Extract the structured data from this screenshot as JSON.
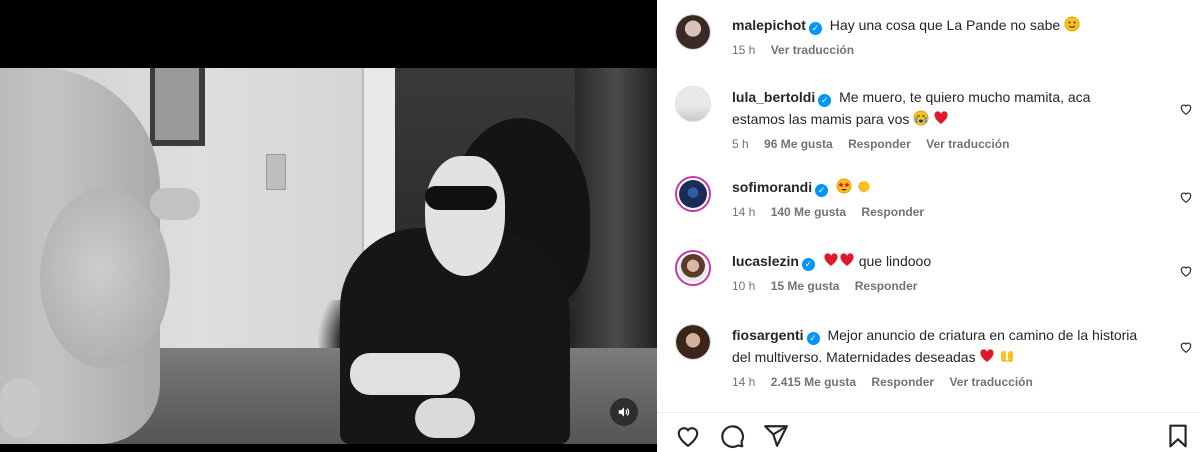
{
  "post": {
    "author": "malepichot",
    "caption": "Hay una cosa que La Pande no sabe",
    "caption_emoji": "slightly-smiling-face-icon",
    "time": "15 h",
    "translate": "Ver traducción"
  },
  "comments": [
    {
      "user": "lula_bertoldi",
      "text": "Me muero, te quiero mucho mamita, aca estamos las mamis para vos",
      "emoji": [
        "crying-face-icon",
        "red-heart-icon"
      ],
      "time": "5 h",
      "likes": "96 Me gusta",
      "reply": "Responder",
      "translate": "Ver traducción"
    },
    {
      "user": "sofimorandi",
      "text": "",
      "emoji": [
        "star-struck-icon",
        "clapping-hands-icon"
      ],
      "time": "14 h",
      "likes": "140 Me gusta",
      "reply": "Responder"
    },
    {
      "user": "lucaslezin",
      "text": "que lindooo",
      "emoji": [
        "red-heart-icon",
        "red-heart-icon"
      ],
      "time": "10 h",
      "likes": "15 Me gusta",
      "reply": "Responder"
    },
    {
      "user": "fiosargenti",
      "text": "Mejor anuncio de criatura en camino de la historia del multiverso. Maternidades deseadas",
      "emoji": [
        "red-heart-icon",
        "raising-hands-icon"
      ],
      "time": "14 h",
      "likes": "2.415 Me gusta",
      "reply": "Responder",
      "translate": "Ver traducción"
    }
  ],
  "icons": {
    "like": "heart-outline-icon",
    "comment": "comment-bubble-icon",
    "share": "paper-plane-icon",
    "save": "bookmark-icon",
    "mute": "speaker-icon"
  },
  "colors": {
    "verified": "#0095f6",
    "heart": "#ed4956",
    "meta": "#737373",
    "text": "#262626"
  }
}
